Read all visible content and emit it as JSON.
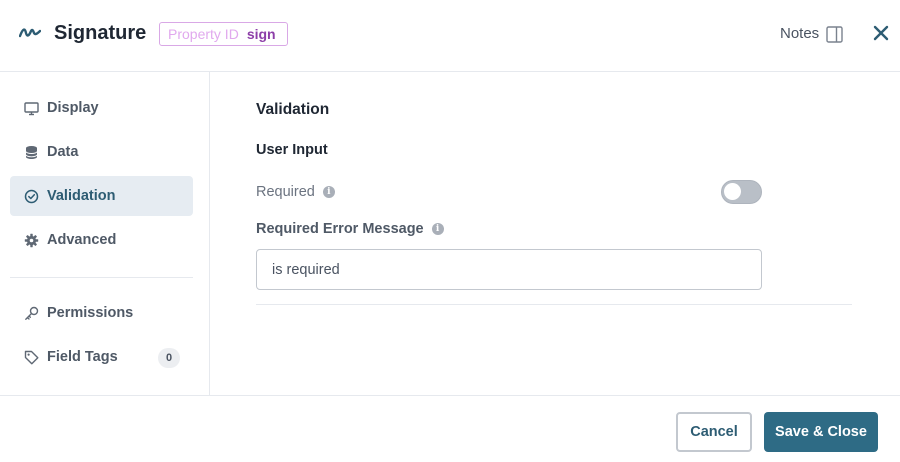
{
  "header": {
    "title": "Signature",
    "property_id_key": "Property ID",
    "property_id_value": "sign",
    "notes_label": "Notes"
  },
  "sidebar": {
    "items": [
      {
        "label": "Display",
        "icon": "monitor-icon"
      },
      {
        "label": "Data",
        "icon": "database-icon"
      },
      {
        "label": "Validation",
        "icon": "check-circle-icon",
        "active": true
      },
      {
        "label": "Advanced",
        "icon": "gear-icon"
      },
      {
        "label": "Permissions",
        "icon": "key-icon"
      },
      {
        "label": "Field Tags",
        "icon": "tag-icon",
        "count": "0"
      }
    ]
  },
  "main": {
    "section_title": "Validation",
    "subsection_title": "User Input",
    "required_label": "Required",
    "required_enabled": false,
    "error_message_label": "Required Error Message",
    "error_message_value": "is required"
  },
  "footer": {
    "cancel_label": "Cancel",
    "save_label": "Save & Close"
  },
  "colors": {
    "accent": "#2e6b85",
    "active_nav_bg": "#e6ecf2",
    "property_badge_border": "#d9a8e6",
    "property_badge_value": "#8d3fa8"
  }
}
